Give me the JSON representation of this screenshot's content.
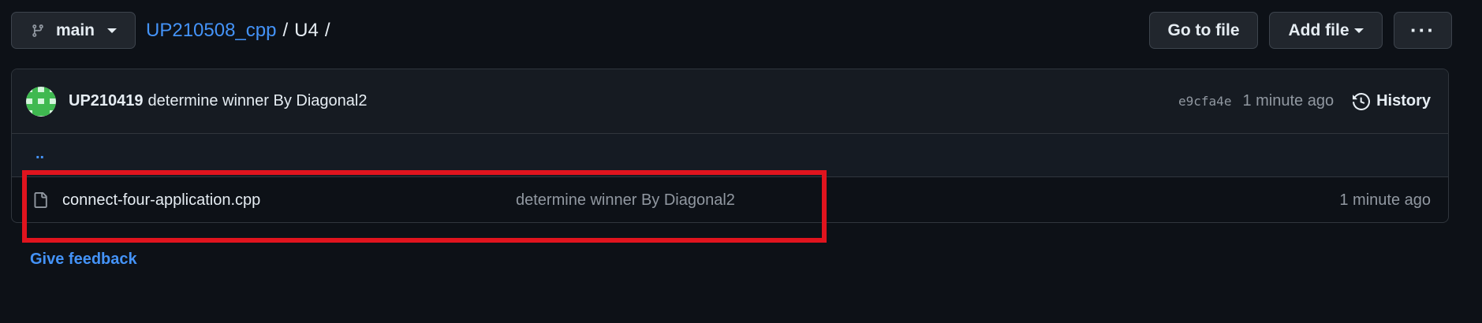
{
  "branch": {
    "label": "main",
    "icon": "git-branch-icon"
  },
  "breadcrumb": {
    "repo": "UP210508_cpp",
    "sep1": "/",
    "dir": "U4",
    "sep2": "/"
  },
  "actions": {
    "go_to_file": "Go to file",
    "add_file": "Add file",
    "more": "···"
  },
  "latest_commit": {
    "author": "UP210419",
    "message": "determine winner By Diagonal2",
    "sha": "e9cfa4e",
    "time": "1 minute ago",
    "history_label": "History"
  },
  "parent_link": "..",
  "files": [
    {
      "name": "connect-four-application.cpp",
      "commit_message": "determine winner By Diagonal2",
      "time": "1 minute ago",
      "icon": "file-icon"
    }
  ],
  "feedback_link": "Give feedback",
  "colors": {
    "accent_link": "#4493f8",
    "highlight_border": "#e0141e",
    "background": "#0d1117"
  }
}
